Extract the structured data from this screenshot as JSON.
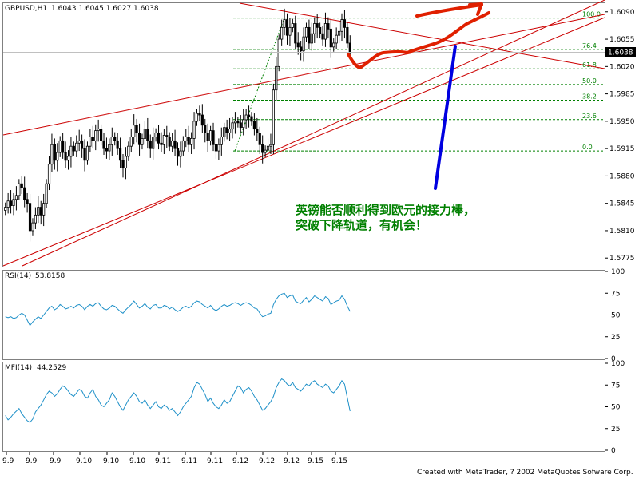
{
  "main": {
    "symbol_label": "GBPUSD,H1",
    "ohlc_label": "1.6043 1.6045 1.6027 1.6038",
    "current_price": "1.6038",
    "y_ticks": [
      "1.6090",
      "1.6055",
      "1.6020",
      "1.5985",
      "1.5950",
      "1.5915",
      "1.5880",
      "1.5845",
      "1.5810",
      "1.5775"
    ],
    "fib_labels": [
      "100.0",
      "76.4",
      "61.8",
      "50.0",
      "38.2",
      "23.6",
      "0.0"
    ],
    "annotation": [
      "英镑能否顺利得到欧元的接力棒，",
      "突破下降轨道，有机会！"
    ]
  },
  "rsi": {
    "label": "RSI(14)",
    "value": "53.8158",
    "y_ticks": [
      "100",
      "75",
      "50",
      "25",
      "0"
    ]
  },
  "mfi": {
    "label": "MFI(14)",
    "value": "44.2529",
    "y_ticks": [
      "100",
      "75",
      "50",
      "25",
      "0"
    ]
  },
  "x_ticks": [
    "9.9",
    "9.9",
    "9.9",
    "9.10",
    "9.10",
    "9.10",
    "9.11",
    "9.11",
    "9.11",
    "9.12",
    "9.12",
    "9.12",
    "9.15",
    "9.15"
  ],
  "footer": "Created with MetaTrader, ? 2002 MetaQuotes Sofware Corp.",
  "colors": {
    "bull_fill": "#ffffff",
    "bear_fill": "#000000",
    "trend": "#cc0000",
    "fib": "#008000",
    "arrow_blue": "#0000e0",
    "arrow_red": "#e02000",
    "indicator": "#1e90c8",
    "text_green": "#008000"
  },
  "chart_data": [
    {
      "type": "candlestick",
      "title": "GBPUSD,H1",
      "ylim": [
        1.5765,
        1.61
      ],
      "close": [
        1.584,
        1.5848,
        1.5842,
        1.585,
        1.5855,
        1.587,
        1.5865,
        1.585,
        1.5845,
        1.581,
        1.582,
        1.583,
        1.584,
        1.583,
        1.5845,
        1.587,
        1.5895,
        1.592,
        1.59,
        1.591,
        1.5925,
        1.591,
        1.59,
        1.5905,
        1.5918,
        1.5912,
        1.5922,
        1.5925,
        1.5915,
        1.59,
        1.5918,
        1.593,
        1.5925,
        1.5938,
        1.594,
        1.5925,
        1.5915,
        1.5912,
        1.592,
        1.593,
        1.5925,
        1.5915,
        1.59,
        1.589,
        1.5905,
        1.5918,
        1.593,
        1.5945,
        1.5935,
        1.592,
        1.5928,
        1.594,
        1.5925,
        1.5915,
        1.593,
        1.5935,
        1.5922,
        1.592,
        1.5932,
        1.593,
        1.5918,
        1.5925,
        1.5915,
        1.5905,
        1.5912,
        1.5925,
        1.593,
        1.592,
        1.5928,
        1.595,
        1.596,
        1.5958,
        1.5945,
        1.5935,
        1.5925,
        1.5938,
        1.592,
        1.5912,
        1.592,
        1.593,
        1.5942,
        1.5935,
        1.594,
        1.5948,
        1.595,
        1.5948,
        1.5942,
        1.5952,
        1.5958,
        1.5956,
        1.595,
        1.594,
        1.5935,
        1.592,
        1.591,
        1.5913,
        1.5918,
        1.592,
        1.599,
        1.602,
        1.6055,
        1.607,
        1.608,
        1.606,
        1.607,
        1.6075,
        1.605,
        1.6045,
        1.604,
        1.6058,
        1.607,
        1.605,
        1.6062,
        1.6075,
        1.607,
        1.6062,
        1.6055,
        1.6075,
        1.6068,
        1.6045,
        1.605,
        1.606,
        1.6065,
        1.608,
        1.607,
        1.605,
        1.6038
      ],
      "fibonacci": {
        "levels": [
          "0.0",
          "23.6",
          "38.2",
          "50.0",
          "61.8",
          "76.4",
          "100.0"
        ],
        "low": 1.5912,
        "high": 1.6082
      },
      "price_label": 1.6038
    },
    {
      "type": "line",
      "title": "RSI(14)",
      "ylim": [
        0,
        100
      ],
      "values": [
        48,
        47,
        48,
        46,
        47,
        50,
        52,
        50,
        44,
        38,
        42,
        45,
        48,
        46,
        50,
        54,
        58,
        60,
        56,
        58,
        62,
        60,
        57,
        58,
        60,
        58,
        61,
        62,
        60,
        56,
        60,
        62,
        60,
        63,
        64,
        60,
        57,
        56,
        58,
        61,
        60,
        57,
        54,
        52,
        56,
        59,
        62,
        66,
        62,
        58,
        60,
        63,
        59,
        57,
        61,
        62,
        58,
        58,
        61,
        60,
        57,
        59,
        56,
        54,
        56,
        59,
        60,
        58,
        60,
        64,
        66,
        65,
        62,
        60,
        58,
        61,
        57,
        55,
        57,
        60,
        62,
        60,
        61,
        63,
        64,
        63,
        61,
        63,
        64,
        63,
        61,
        58,
        57,
        52,
        48,
        49,
        51,
        52,
        62,
        68,
        72,
        74,
        75,
        70,
        72,
        73,
        66,
        64,
        63,
        67,
        70,
        65,
        68,
        72,
        70,
        68,
        66,
        71,
        69,
        62,
        64,
        66,
        67,
        72,
        68,
        60,
        54
      ]
    },
    {
      "type": "line",
      "title": "MFI(14)",
      "ylim": [
        0,
        100
      ],
      "values": [
        40,
        35,
        38,
        42,
        45,
        48,
        42,
        38,
        34,
        32,
        36,
        44,
        48,
        52,
        58,
        64,
        68,
        66,
        62,
        65,
        70,
        74,
        72,
        68,
        64,
        62,
        66,
        70,
        68,
        62,
        60,
        66,
        70,
        62,
        58,
        52,
        50,
        54,
        58,
        66,
        62,
        56,
        50,
        46,
        52,
        58,
        62,
        66,
        62,
        56,
        54,
        58,
        52,
        48,
        52,
        56,
        50,
        48,
        52,
        50,
        46,
        48,
        44,
        40,
        44,
        50,
        54,
        58,
        62,
        72,
        78,
        76,
        70,
        64,
        56,
        60,
        54,
        50,
        48,
        52,
        58,
        54,
        56,
        62,
        68,
        74,
        72,
        66,
        70,
        72,
        68,
        62,
        58,
        52,
        46,
        48,
        52,
        56,
        62,
        72,
        78,
        82,
        80,
        76,
        74,
        78,
        72,
        70,
        68,
        72,
        76,
        74,
        78,
        80,
        76,
        74,
        72,
        76,
        74,
        68,
        66,
        70,
        74,
        80,
        76,
        60,
        45
      ]
    }
  ]
}
